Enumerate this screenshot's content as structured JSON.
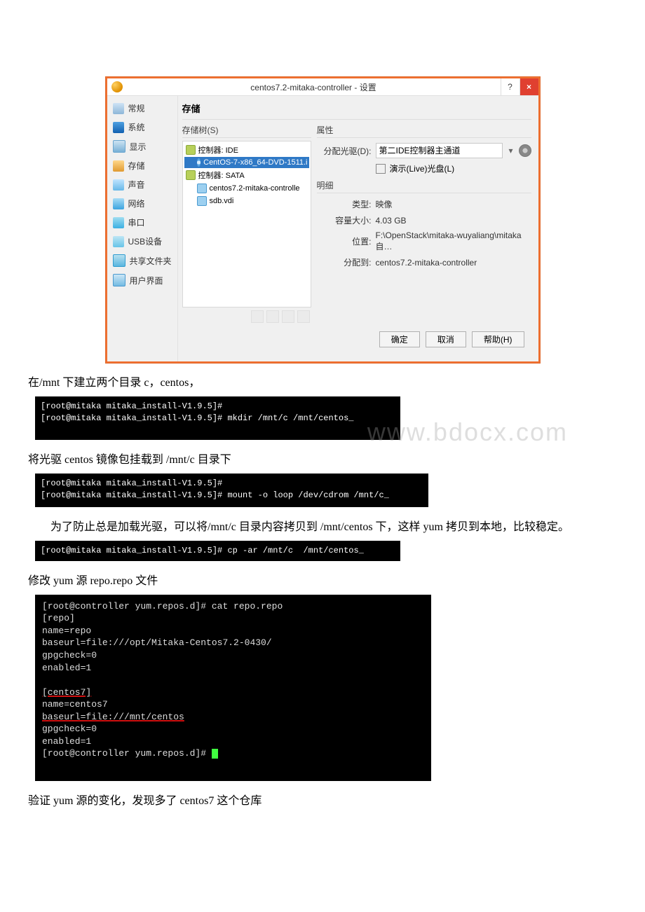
{
  "vb": {
    "title": "centos7.2-mitaka-controller - 设置",
    "help_glyph": "?",
    "close_glyph": "×",
    "nav": {
      "general": "常规",
      "system": "系统",
      "display": "显示",
      "storage": "存储",
      "audio": "声音",
      "network": "网络",
      "serial": "串口",
      "usb": "USB设备",
      "shared": "共享文件夹",
      "ui": "用户界面"
    },
    "heading": "存储",
    "tree_label": "存储树(S)",
    "tree": {
      "ide": "控制器: IDE",
      "dvd": "CentOS-7-x86_64-DVD-1511.i",
      "sata": "控制器: SATA",
      "disk1": "centos7.2-mitaka-controlle",
      "disk2": "sdb.vdi"
    },
    "attr_label": "属性",
    "drive_label": "分配光驱(D):",
    "drive_value": "第二IDE控制器主通道",
    "live_label": "演示(Live)光盘(L)",
    "detail_label": "明细",
    "type_label": "类型:",
    "type_value": "映像",
    "size_label": "容量大小:",
    "size_value": "4.03  GB",
    "loc_label": "位置:",
    "loc_value": "F:\\OpenStack\\mitaka-wuyaliang\\mitaka自…",
    "assigned_label": "分配到:",
    "assigned_value": "centos7.2-mitaka-controller",
    "ok": "确定",
    "cancel": "取消",
    "help": "帮助(H)"
  },
  "doc": {
    "p1": "在/mnt 下建立两个目录 c，centos，",
    "p2": "将光驱 centos 镜像包挂载到 /mnt/c 目录下",
    "p3": "为了防止总是加载光驱，可以将/mnt/c 目录内容拷贝到 /mnt/centos 下，这样 yum 拷贝到本地，比较稳定。",
    "p4": "修改 yum 源 repo.repo 文件",
    "p5": "验证 yum 源的变化，发现多了 centos7 这个仓库"
  },
  "term1": {
    "l1": "[root@mitaka mitaka_install-V1.9.5]#",
    "l2": "[root@mitaka mitaka_install-V1.9.5]# mkdir /mnt/c /mnt/centos_"
  },
  "term2": {
    "l1": "[root@mitaka mitaka_install-V1.9.5]#",
    "l2": "[root@mitaka mitaka_install-V1.9.5]# mount -o loop /dev/cdrom /mnt/c_"
  },
  "term3": {
    "l1": "[root@mitaka mitaka_install-V1.9.5]# cp -ar /mnt/c  /mnt/centos_"
  },
  "term4": {
    "l1": "[root@controller yum.repos.d]# cat repo.repo",
    "l2": "[repo]",
    "l3": "name=repo",
    "l4": "baseurl=file:///opt/Mitaka-Centos7.2-0430/",
    "l5": "gpgcheck=0",
    "l6": "enabled=1",
    "l7": "",
    "l8": "[centos7]",
    "l9": "name=centos7",
    "l10": "baseurl=file:///mnt/centos",
    "l11": "gpgcheck=0",
    "l12": "enabled=1",
    "l13": "[root@controller yum.repos.d]# "
  },
  "watermark": "www.bdocx.com"
}
